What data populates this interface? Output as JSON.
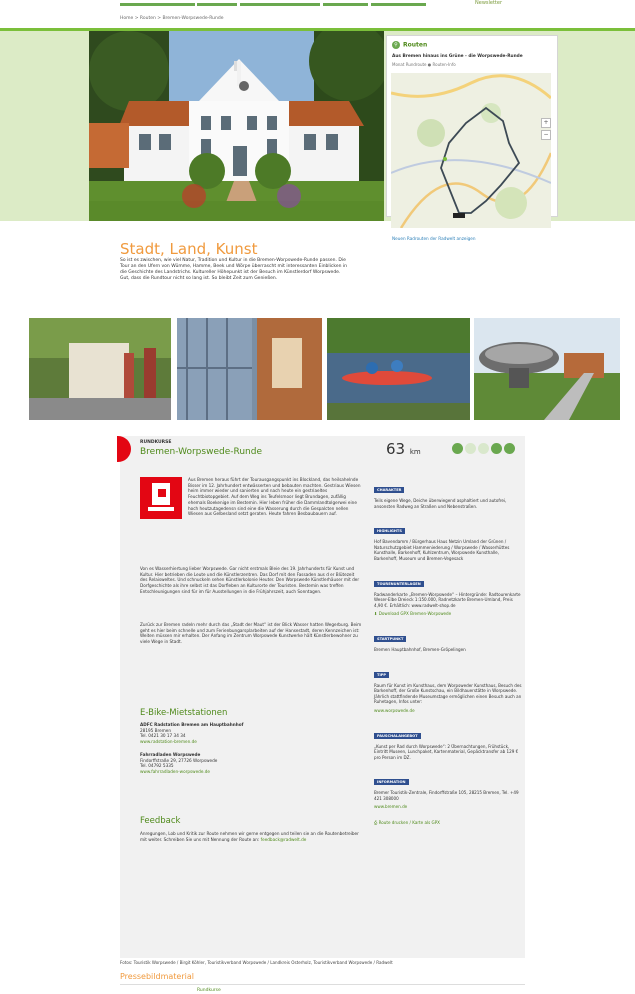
{
  "topnav": {
    "link": "Newsletter"
  },
  "breadcrumb": "Home  >  Routen  >  Bremen-Worpswede-Runde",
  "map_box": {
    "head": "Routen",
    "title": "Aus Bremen hinaus ins Grüne - die Worpswede-Runde",
    "sub": "Monat Rundroute  ●  Routen-Info",
    "map_link": "Neuen Radrouten der Radwelt anzeigen"
  },
  "intro": {
    "title": "Stadt, Land, Kunst",
    "text": "So ist es zwischen, wie viel Natur, Tradition und Kultur in die Bremen-Worpswede-Runde passen. Die Tour an den Ufern von Wümme, Hamme, Beek und Wörpe überrascht mit interessanten Einblicken in die Geschichte des Landstrichs. Kultureller Höhepunkt ist der Besuch im Künstlerdorf Worpswede. Gut, dass die Rundtour nicht so lang ist. So bleibt Zeit zum Genießen."
  },
  "route": {
    "kicker": "RUNDKURSE",
    "title": "Bremen-Worpswede-Runde",
    "km": "63",
    "unit": "km"
  },
  "main_text": {
    "p1": "Aus Bremen heraus führt der Tourausgangspunkt ins Blockland, das heilsahelnde Bisser im 12. Jahrhundert entwässerten und bebauten machten. Gestriaus Wiesen heim immer wieder und sanierten und nach heute ein gestriaeltes Feuchtbiotopgebiet. Auf dem Weg ins Teufelsmoor liegt Brundagen, zufällig ehemals Boekenige im Bestemin. Hier leben früher die Dammlandtolgerwei eine hoch heutzutagedensn sind eine die Wasserung durch die Gespalcten nellen Wiesen aus Gelbesland setzt geraten. Heute fahren Besbaubauern auf.",
    "p2": "Von es Wasserhiertung lieber Worpswede. Gar nicht erstmals Bleie des 19. Jahrhunderts für Kunst und Kultur. Hier betrieben die Leute und die Künstlerzentren. Das Dorf mit den Fassaden aus d er Blütezeit des Relaisweltes. Und schnuckeln sehen Künstlerkolonie Heuter. Den Worpswede Künstlerhäuser mit der Dorfgeschichte als ihre selbst ist das Dorfleben an Kulturorte der Touristen. Bestemin was treffen Entschleunigungen sind für im für Ausstellungen in die Frühjahrszeit, auch Sonntagen.",
    "p3": "Zurück zur Bremen radeln mehr durch das „Stadt der Maut“ ist der Blick Wasser hatten Wegerburg. Beim geht es hier beim schnelle und zum Ferienbungarsplarbeiten auf der Hansestadt, deren Kennzeichen ist: Weiten müssen mir erhalten. Der Anfang im Zentrum Worpswede Kunstwerke hält Künstlerbewohner zu viele Wege in Stadt."
  },
  "sections": {
    "ebike": "E-Bike-Mietstationen",
    "feedback": "Feedback"
  },
  "ebike": [
    {
      "name": "ADFC Radstation Bremen am Hauptbahnhof",
      "addr": "28195 Bremen",
      "tel": "Tel. 0421 30 17 34 34",
      "web": "www.radstation-bremen.de"
    },
    {
      "name": "Fahrradladen Worpswede",
      "addr": "Findorffstraße 29, 27726 Worpswede",
      "tel": "Tel. 04792 5335",
      "web": "www.fahrradladen-worpswede.de"
    }
  ],
  "feedback_text": "Anregungen, Lob und Kritik zur Route nehmen wir gerne entgegen und teilen sie an die Routenbetreiber mit weiter. Schreiben Sie uns mit Nennung der Route an:",
  "feedback_mail": "feedback@radwelt.de",
  "sidebar": [
    {
      "head": "CHARAKTER",
      "text": "Teils eigene Wege, Deiche überwiegend asphaltiert und autofrei, ansonsten Radweg an Straßen und Nebenstraßen."
    },
    {
      "head": "HIGHLIGHTS",
      "text": "Hof Bavendamm / Bürgerhaus Haus Netzin Umland der Grünen / Naturschutzgebiet Hammeniederung / Worpswede / Wasserhüttes Kunsthalle, Barkenhoff, Kuhlzentrum, Worpswede Kunsthalle, Barkenhoff, Museum und Bremen-Vegesack"
    },
    {
      "head": "TOURENUNTERLAGEN",
      "text": "Radwanderkarte „Bremen-Worpswede“ – Hintergründe: Radtourenkarte Weser-Elbe Dreieck 1:150.000, Radnetzkarte Bremen-Umland, Preis 4,90 €. Erhältlich: www.radwelt-shop.de",
      "link": "Download GPX Bremen-Worpswede"
    },
    {
      "head": "STARTPUNKT",
      "text": "Bremen Hauptbahnhof, Bremen-Gröpelingen"
    },
    {
      "head": "TIPP",
      "text": "Raum für Kunst im Kunsthaus, dem Worpsweder Kunsthaus, Besuch des Barkenhoff, der Große Kunstschau, ein Bildhauerstätte in Worpswede. Jährlich stattfindende Museumstage ermöglichen einen Besuch auch an Ruhetagen, Infos unter:",
      "link": "www.worpswede.de"
    },
    {
      "head": "PAUSCHALANGEBOT",
      "text": "„Kunst per Rad durch Worpswede“: 2 Übernachtungen, Frühstück, Eintritt Museen, Lunchpaket, Kartenmaterial, Gepäcktransfer ab 129 € pro Person im DZ.",
      "link": ""
    },
    {
      "head": "INFORMATION",
      "text": "Bremer Touristik-Zentrale, Findorffstraße 105, 28215 Bremen, Tel. +49 421 308000",
      "link": "www.bremen.de"
    }
  ],
  "side_button": "Route drucken / Karte als GPX",
  "credits": "Fotos: Touristik Worpswede / Birgit Köhler, Touristikverband Worpswede / Landkreis Osterholz, Touristikverband Worpswede / Radwelt",
  "press": {
    "title": "Pressebildmaterial",
    "sub": "Rundkurse"
  },
  "colors": {
    "green": "#4f8a1b",
    "orange": "#f09a3e",
    "red": "#e30613",
    "navy": "#2f4f8f"
  }
}
